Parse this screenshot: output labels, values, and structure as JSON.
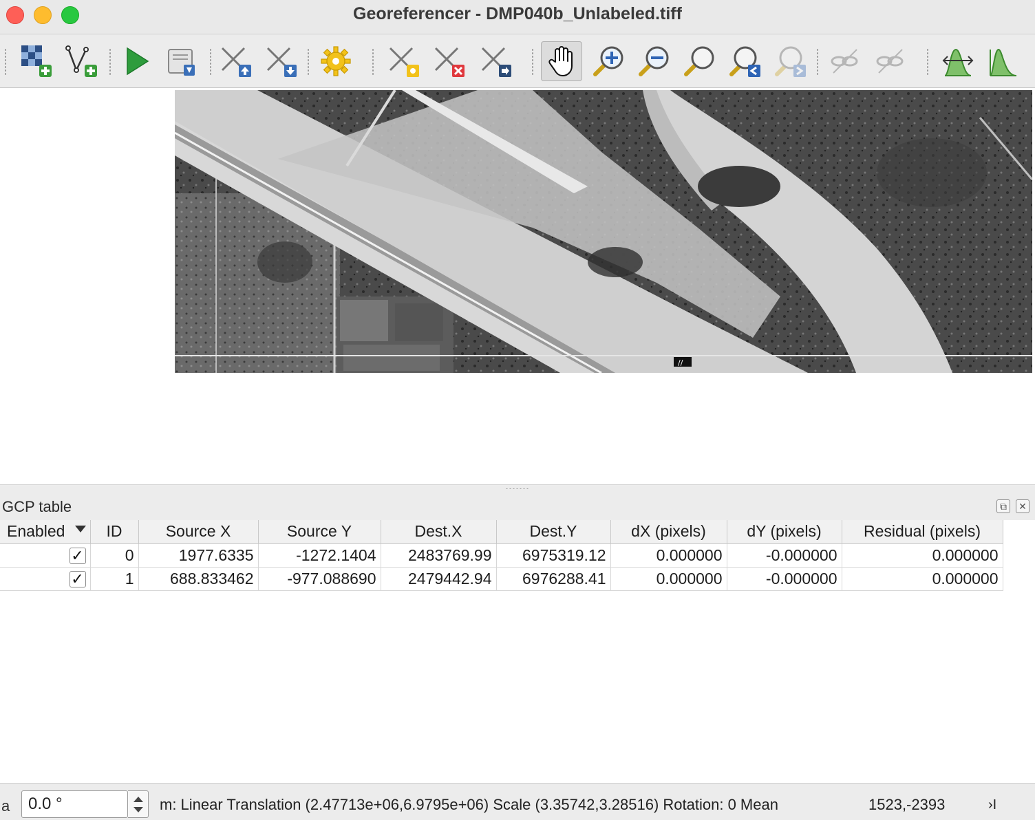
{
  "window": {
    "title": "Georeferencer - DMP040b_Unlabeled.tiff"
  },
  "toolbar": {
    "buttons": [
      {
        "name": "open-raster",
        "icon": "raster-add-icon"
      },
      {
        "name": "start-georeferencing",
        "icon": "play-icon"
      },
      {
        "name": "generate-gdal-script",
        "icon": "script-icon"
      },
      {
        "name": "load-gcp-points",
        "icon": "gcp-load-icon"
      },
      {
        "name": "save-gcp-points",
        "icon": "gcp-save-icon"
      },
      {
        "name": "transformation-settings",
        "icon": "gear-icon"
      },
      {
        "name": "add-point",
        "icon": "add-point-icon"
      },
      {
        "name": "delete-point",
        "icon": "delete-point-icon"
      },
      {
        "name": "move-gcp-point",
        "icon": "move-point-icon"
      },
      {
        "name": "pan",
        "icon": "hand-icon",
        "active": true
      },
      {
        "name": "zoom-in",
        "icon": "zoom-in-icon"
      },
      {
        "name": "zoom-out",
        "icon": "zoom-out-icon"
      },
      {
        "name": "zoom-to-layer",
        "icon": "zoom-layer-icon"
      },
      {
        "name": "zoom-last",
        "icon": "zoom-last-icon"
      },
      {
        "name": "zoom-next",
        "icon": "zoom-next-icon",
        "disabled": true
      },
      {
        "name": "link-georeferencer",
        "icon": "link-geo-icon",
        "disabled": true
      },
      {
        "name": "link-qgis",
        "icon": "link-qgis-icon",
        "disabled": true
      },
      {
        "name": "full-histogram-stretch",
        "icon": "histogram-stretch-icon"
      },
      {
        "name": "local-histogram-stretch",
        "icon": "histogram-icon"
      }
    ]
  },
  "gcp": {
    "title": "GCP table",
    "columns": [
      "Enabled",
      "ID",
      "Source X",
      "Source Y",
      "Dest.X",
      "Dest.Y",
      "dX (pixels)",
      "dY (pixels)",
      "Residual (pixels)"
    ],
    "rows": [
      {
        "enabled": "✓",
        "id": "0",
        "source_x": "1977.6335",
        "source_y": "-1272.1404",
        "dest_x": "2483769.99",
        "dest_y": "6975319.12",
        "dx": "0.000000",
        "dy": "-0.000000",
        "residual": "0.000000"
      },
      {
        "enabled": "✓",
        "id": "1",
        "source_x": "688.833462",
        "source_y": "-977.088690",
        "dest_x": "2479442.94",
        "dest_y": "6976288.41",
        "dx": "0.000000",
        "dy": "-0.000000",
        "residual": "0.000000"
      }
    ]
  },
  "status": {
    "left_label": "a",
    "rotation": "0.0 °",
    "transform": "m: Linear Translation (2.47713e+06,6.9795e+06) Scale (3.35742,3.28516) Rotation: 0 Mean",
    "coordinates": "1523,-2393",
    "more": "›I"
  }
}
